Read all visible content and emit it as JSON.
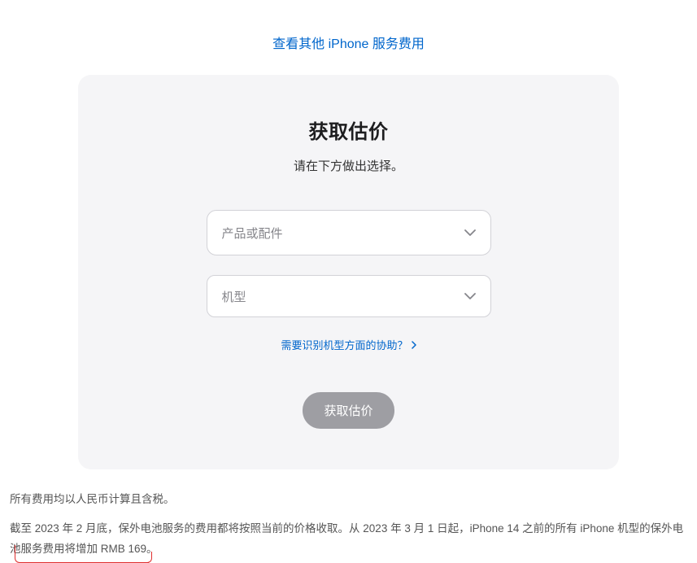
{
  "topLink": {
    "text": "查看其他 iPhone 服务费用"
  },
  "card": {
    "title": "获取估价",
    "subtitle": "请在下方做出选择。",
    "select1": {
      "placeholder": "产品或配件"
    },
    "select2": {
      "placeholder": "机型"
    },
    "helpLink": {
      "text": "需要识别机型方面的协助？"
    },
    "submitButton": {
      "label": "获取估价"
    }
  },
  "footer": {
    "line1": "所有费用均以人民币计算且含税。",
    "line2_part1": "截至 2023 年 2 月底，保外电池服务的费用都将按照当前的价格收取。从 2023 年 3 月 1 日起，iPhone 14 之前的所有 iPhone 机型的保外电池服务",
    "line2_part2": "费用将增加 RMB 169。"
  }
}
